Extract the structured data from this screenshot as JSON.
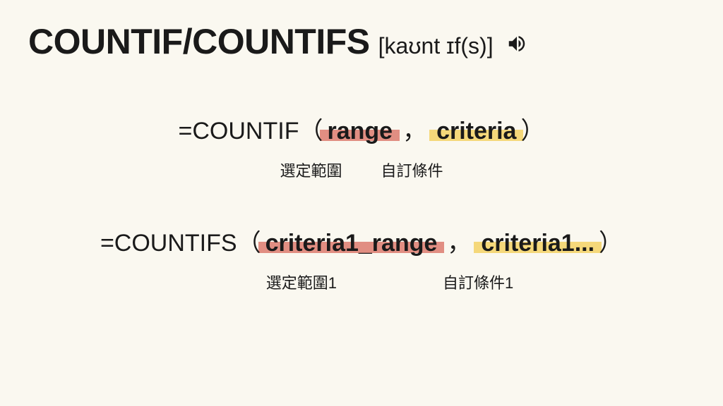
{
  "header": {
    "title": "COUNTIF/COUNTIFS",
    "pronunciation": "[kaʊnt ɪf(s)]",
    "icon_name": "speaker-icon"
  },
  "formula1": {
    "equals": "=",
    "func": "COUNTIF",
    "open": "（",
    "arg1": "range",
    "comma": "，",
    "arg2": "criteria",
    "close": "）",
    "note1": "選定範圍",
    "note2": "自訂條件"
  },
  "formula2": {
    "equals": "=",
    "func": "COUNTIFS",
    "open": "（",
    "arg1": "criteria1_range",
    "comma": "，",
    "arg2": "criteria1...",
    "close": "）",
    "note1": "選定範圍1",
    "note2": "自訂條件1"
  }
}
